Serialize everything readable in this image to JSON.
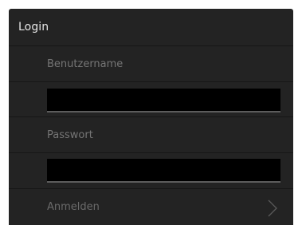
{
  "header": {
    "title": "Login"
  },
  "username": {
    "label": "Benutzername",
    "value": ""
  },
  "password": {
    "label": "Passwort",
    "value": ""
  },
  "submit": {
    "label": "Anmelden",
    "icon": "chevron-right-icon"
  },
  "colors": {
    "panel_background": "#232323",
    "input_background": "#000000",
    "input_underline": "#5c5c5c",
    "title_text": "#e6e6e6",
    "muted_text": "#757575"
  }
}
